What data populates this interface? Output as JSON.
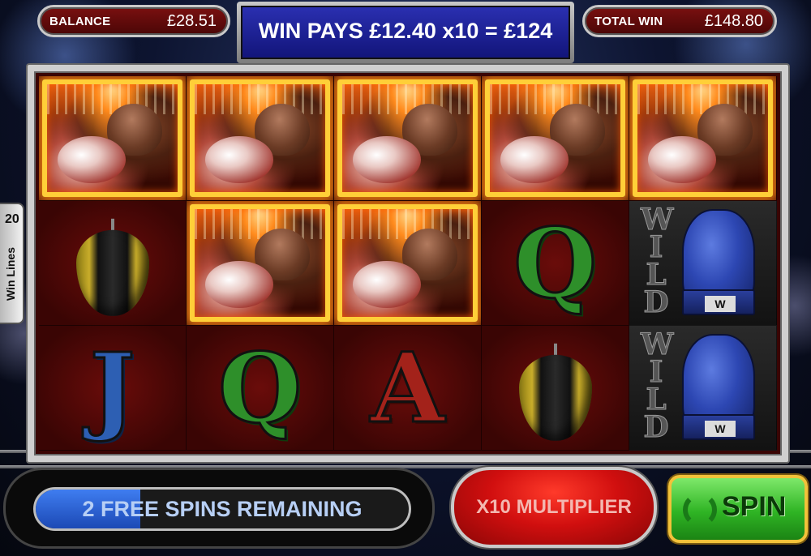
{
  "header": {
    "balance_label": "BALANCE",
    "balance_value": "£28.51",
    "win_message": "WIN PAYS £12.40 x10 = £124",
    "total_win_label": "TOTAL WIN",
    "total_win_value": "£148.80"
  },
  "win_lines_tab": {
    "count": "20",
    "label": "Win Lines"
  },
  "reels": [
    [
      "boxer",
      "punch-bag",
      "J"
    ],
    [
      "boxer",
      "boxer",
      "Q"
    ],
    [
      "boxer",
      "boxer",
      "A"
    ],
    [
      "boxer",
      "Q",
      "punch-bag"
    ],
    [
      "boxer",
      "wild",
      "wild"
    ]
  ],
  "symbols": {
    "q": "Q",
    "j": "J",
    "a": "A",
    "wild_word": "WILD",
    "wild_badge": "W"
  },
  "bottom": {
    "free_spins_text": "2 FREE SPINS REMAINING",
    "multiplier_text": "X10 MULTIPLIER",
    "spin_label": "SPIN"
  },
  "colors": {
    "win_box": "#2a2fb0",
    "panel_red": "#7a1010",
    "spin_green": "#2fb424",
    "free_spins_blue": "#3f7df0"
  }
}
